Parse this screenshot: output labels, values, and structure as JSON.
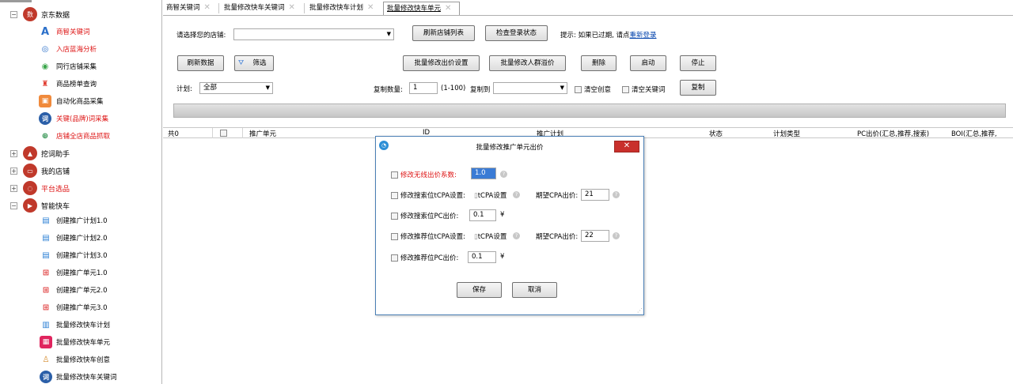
{
  "sidebar": {
    "groups": [
      {
        "label": "京东数据",
        "icon": "jd-data-icon",
        "expanded": true
      },
      {
        "label": "挖词助手",
        "icon": "word-mining-icon",
        "expanded": false
      },
      {
        "label": "我的店铺",
        "icon": "my-shop-icon",
        "expanded": false
      },
      {
        "label": "平台选品",
        "icon": "platform-selection-icon",
        "expanded": false
      },
      {
        "label": "智能快车",
        "icon": "smart-express-icon",
        "expanded": true
      }
    ],
    "jd_items": [
      {
        "label": "商智关键词",
        "icon": "font-a-icon",
        "red": true
      },
      {
        "label": "入店蓝海分析",
        "icon": "target-icon",
        "red": true
      },
      {
        "label": "同行店铺采集",
        "icon": "eye-icon",
        "red": false
      },
      {
        "label": "商品榜单查询",
        "icon": "medal-icon",
        "red": false
      },
      {
        "label": "自动化商品采集",
        "icon": "bag-icon",
        "red": false
      },
      {
        "label": "关键(品牌)词采集",
        "icon": "word-icon",
        "red": true
      },
      {
        "label": "店铺全店商品抓取",
        "icon": "globe-search-icon",
        "red": true
      }
    ],
    "express_items": [
      {
        "label": "创建推广计划1.0",
        "icon": "plan-icon"
      },
      {
        "label": "创建推广计划2.0",
        "icon": "plan-icon"
      },
      {
        "label": "创建推广计划3.0",
        "icon": "plan-icon"
      },
      {
        "label": "创建推广单元1.0",
        "icon": "unit-icon"
      },
      {
        "label": "创建推广单元2.0",
        "icon": "unit-icon"
      },
      {
        "label": "创建推广单元3.0",
        "icon": "unit-icon"
      },
      {
        "label": "批量修改快车计划",
        "icon": "edit-plan-icon"
      },
      {
        "label": "批量修改快车单元",
        "icon": "edit-unit-icon"
      },
      {
        "label": "批量修改快车创意",
        "icon": "creative-icon"
      },
      {
        "label": "批量修改快车关键词",
        "icon": "word-icon"
      }
    ]
  },
  "tabs": [
    {
      "label": "商智关键词",
      "active": false
    },
    {
      "label": "批量修改快车关键词",
      "active": false
    },
    {
      "label": "批量修改快车计划",
      "active": false
    },
    {
      "label": "批量修改快车单元",
      "active": true
    }
  ],
  "toolbar": {
    "shop_label": "请选择您的店铺:",
    "shop_value": "",
    "refresh_shops": "刷新店铺列表",
    "check_login": "检查登录状态",
    "hint_prefix": "提示: 如果已过期, 请点",
    "hint_link": "重新登录",
    "refresh_data": "刷新数据",
    "filter": "筛选",
    "batch_bid": "批量修改出价设置",
    "batch_audience": "批量修改人群溢价",
    "delete": "删除",
    "start": "启动",
    "stop": "停止",
    "plan_label": "计划:",
    "plan_value": "全部",
    "copy_count_label": "复制数量:",
    "copy_count_value": "1",
    "copy_range": "(1-100)",
    "copy_to_label": "复制到",
    "copy_to_value": "",
    "clear_creative": "清空创意",
    "clear_keywords": "清空关键词",
    "copy": "复制"
  },
  "grid": {
    "total": "共0",
    "columns": [
      "推广单元",
      "ID",
      "推广计划",
      "状态",
      "计划类型",
      "PC出价(汇总,推荐,搜索)",
      "BOI(汇总,推荐,"
    ]
  },
  "dialog": {
    "title": "批量修改推广单元出价",
    "close_label": "✕",
    "fields": {
      "unlimited_coef_label": "修改无线出价系数:",
      "unlimited_coef_value": "1.0",
      "search_tcpa_label": "修改搜索位tCPA设置:",
      "search_tcpa_toggle": "tCPA设置",
      "search_cpa_label": "期望CPA出价:",
      "search_cpa_value": "21",
      "search_pc_label": "修改搜索位PC出价:",
      "search_pc_value": "0.1",
      "search_pc_unit": "¥",
      "rec_tcpa_label": "修改推荐位tCPA设置:",
      "rec_tcpa_toggle": "tCPA设置",
      "rec_cpa_label": "期望CPA出价:",
      "rec_cpa_value": "22",
      "rec_pc_label": "修改推荐位PC出价:",
      "rec_pc_value": "0.1",
      "rec_pc_unit": "¥"
    },
    "save": "保存",
    "cancel": "取消"
  },
  "colors": {
    "accent_red": "#d11111",
    "link_blue": "#0645ad",
    "close_red": "#c9302c"
  }
}
